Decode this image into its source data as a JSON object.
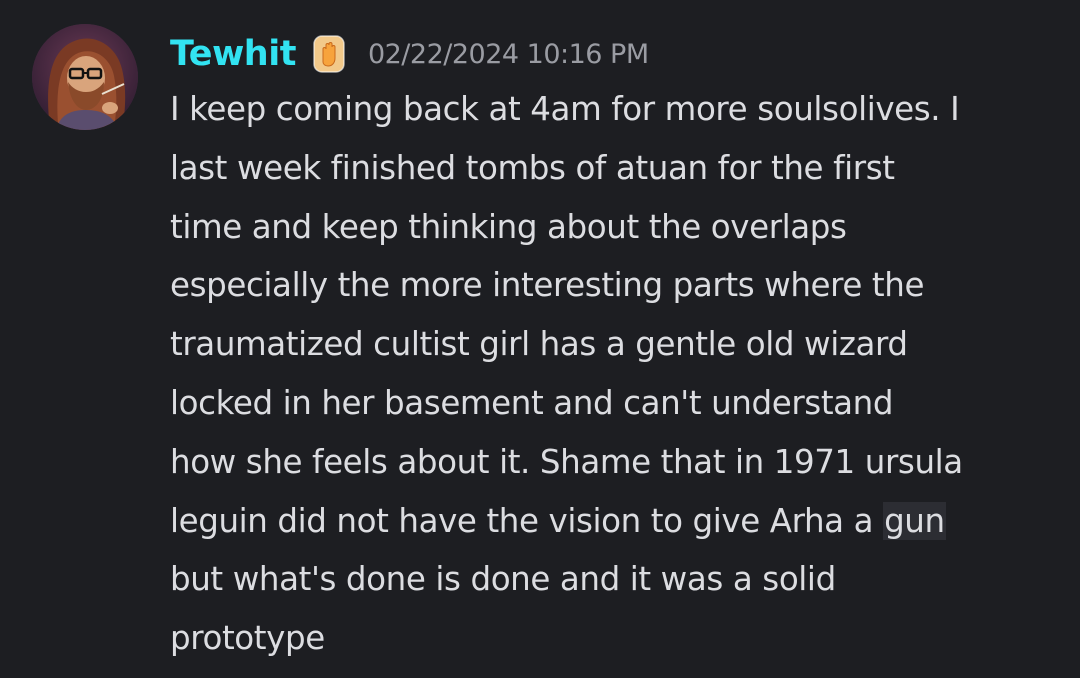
{
  "message": {
    "author": "Tewhit",
    "badge_icon": "raised-hand-icon",
    "timestamp": "02/22/2024 10:16 PM",
    "lines": [
      "I keep coming back at 4am for more soulsolives. I",
      "last week finished tombs of atuan for the first",
      "time and keep thinking about the overlaps",
      "especially the more interesting parts where the",
      "traumatized cultist girl has a gentle old wizard",
      "locked in her basement and can't understand",
      "how she feels about it. Shame that in 1971 ursula",
      "leguin did not have the vision to give Arha a ",
      "but what's done is done and it was a solid",
      "prototype"
    ],
    "highlighted_word": "gun",
    "colors": {
      "background": "#1d1e22",
      "username": "#32e3f2",
      "timestamp": "#9a9ca3",
      "text": "#dcdde1",
      "highlight": "#2c2d33"
    }
  }
}
